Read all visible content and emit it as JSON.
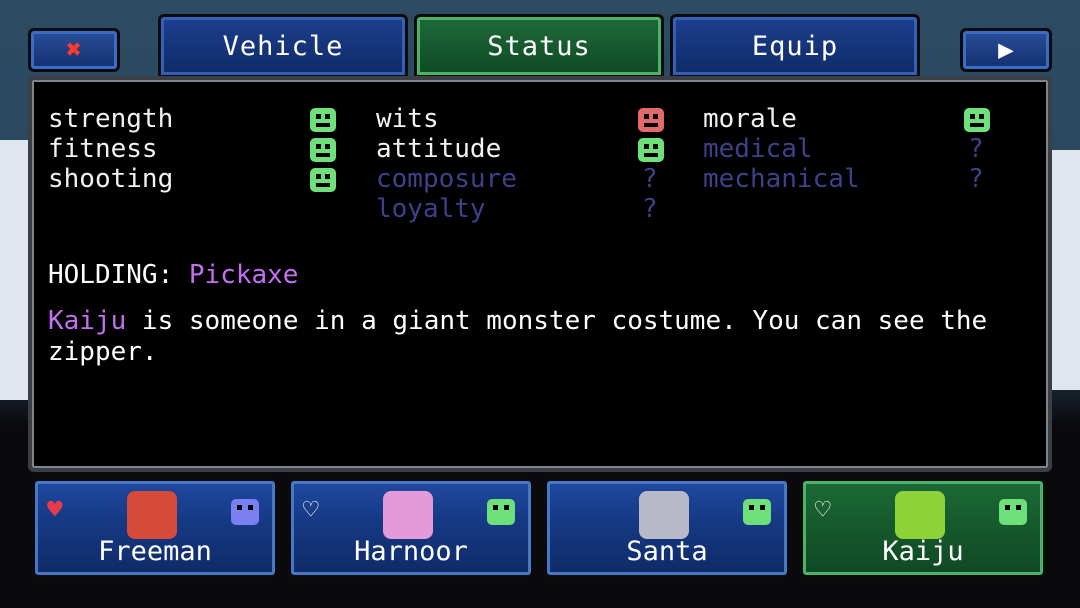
{
  "tabs": {
    "close_icon": "✖",
    "next_icon": "▶",
    "items": [
      {
        "label": "Vehicle",
        "active": false
      },
      {
        "label": "Status",
        "active": true
      },
      {
        "label": "Equip",
        "active": false
      }
    ]
  },
  "stats": {
    "col1": [
      {
        "name": "strength",
        "mood": "good"
      },
      {
        "name": "fitness",
        "mood": "good"
      },
      {
        "name": "shooting",
        "mood": "good"
      }
    ],
    "col2": [
      {
        "name": "wits",
        "mood": "bad"
      },
      {
        "name": "attitude",
        "mood": "good"
      },
      {
        "name": "composure",
        "mood": "?"
      },
      {
        "name": "loyalty",
        "mood": "?"
      }
    ],
    "col3": [
      {
        "name": "morale",
        "mood": "good"
      },
      {
        "name": "medical",
        "mood": "?"
      },
      {
        "name": "mechanical",
        "mood": "?"
      }
    ]
  },
  "holding": {
    "label": "HOLDING:",
    "item": "Pickaxe"
  },
  "description": {
    "name": "Kaiju",
    "text": " is someone in a giant monster costume. You can see the zipper."
  },
  "party": [
    {
      "name": "Freeman",
      "heart": "♥",
      "heart_color": "#e83a4a",
      "mood_color": "#7a80f0",
      "portrait_color": "#d64a3a",
      "active": false
    },
    {
      "name": "Harnoor",
      "heart": "♡",
      "heart_color": "#ffffff",
      "mood_color": "#6ee07a",
      "portrait_color": "#e49ad8",
      "active": false
    },
    {
      "name": "Santa",
      "heart": "",
      "heart_color": "#ffffff",
      "mood_color": "#6ee07a",
      "portrait_color": "#b8b8c8",
      "active": false
    },
    {
      "name": "Kaiju",
      "heart": "♡",
      "heart_color": "#ffffff",
      "mood_color": "#6ee07a",
      "portrait_color": "#8ed23a",
      "active": true
    }
  ],
  "colors": {
    "good": "#6ee07a",
    "bad": "#e26a6a",
    "unknown": "#3f3f8a",
    "highlight": "#c46ef0"
  }
}
